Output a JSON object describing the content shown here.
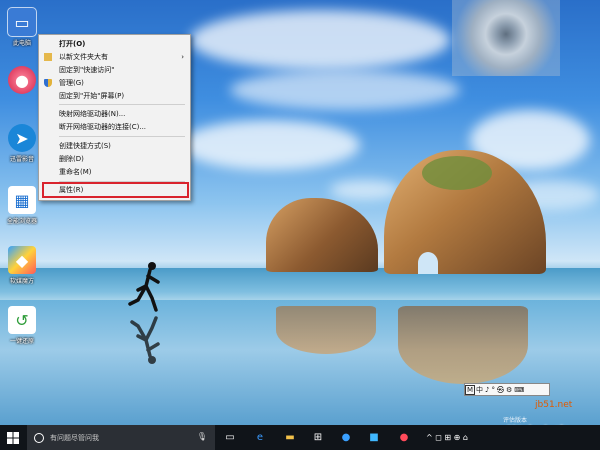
{
  "desktop_icons": [
    {
      "label": "此电脑",
      "icon": "computer-icon"
    },
    {
      "label": "",
      "icon": "red-app-icon"
    },
    {
      "label": "迅雷影音",
      "icon": "blue-app-icon"
    },
    {
      "label": "全能浏览器",
      "icon": "window-app-icon"
    },
    {
      "label": "软媒魔方",
      "icon": "cube-app-icon"
    },
    {
      "label": "一键还原",
      "icon": "restore-app-icon"
    }
  ],
  "context_menu": {
    "items": [
      {
        "label": "打开(O)",
        "bold": true,
        "icon": ""
      },
      {
        "label": "以新文件夹大有",
        "icon": "folder-icon",
        "has_submenu": true
      },
      {
        "label": "固定到\"快速访问\"",
        "icon": ""
      },
      {
        "label": "管理(G)",
        "icon": "shield-icon"
      },
      {
        "label": "固定到\"开始\"屏幕(P)",
        "icon": ""
      },
      {
        "label": "映射网络驱动器(N)...",
        "icon": ""
      },
      {
        "label": "断开网络驱动器的连接(C)...",
        "icon": ""
      },
      {
        "label": "创建快捷方式(S)",
        "icon": ""
      },
      {
        "label": "删除(D)",
        "icon": ""
      },
      {
        "label": "重命名(M)",
        "icon": ""
      },
      {
        "label": "属性(R)",
        "icon": "",
        "highlighted": true
      }
    ]
  },
  "ime_bar": {
    "items": [
      "M",
      "中",
      "♪",
      "°",
      "㉿",
      "⚙",
      "⌨"
    ]
  },
  "activate_text": "评估版本",
  "watermark": {
    "site": "jb51.net",
    "brand": "脚本之家"
  },
  "taskbar": {
    "search_placeholder": "有问题尽管问我",
    "tray_text": "^ ◻ ⊞ ⊕ ⌂"
  },
  "colors": {
    "highlight_border": "#d9232d",
    "taskbar": "#101419"
  }
}
